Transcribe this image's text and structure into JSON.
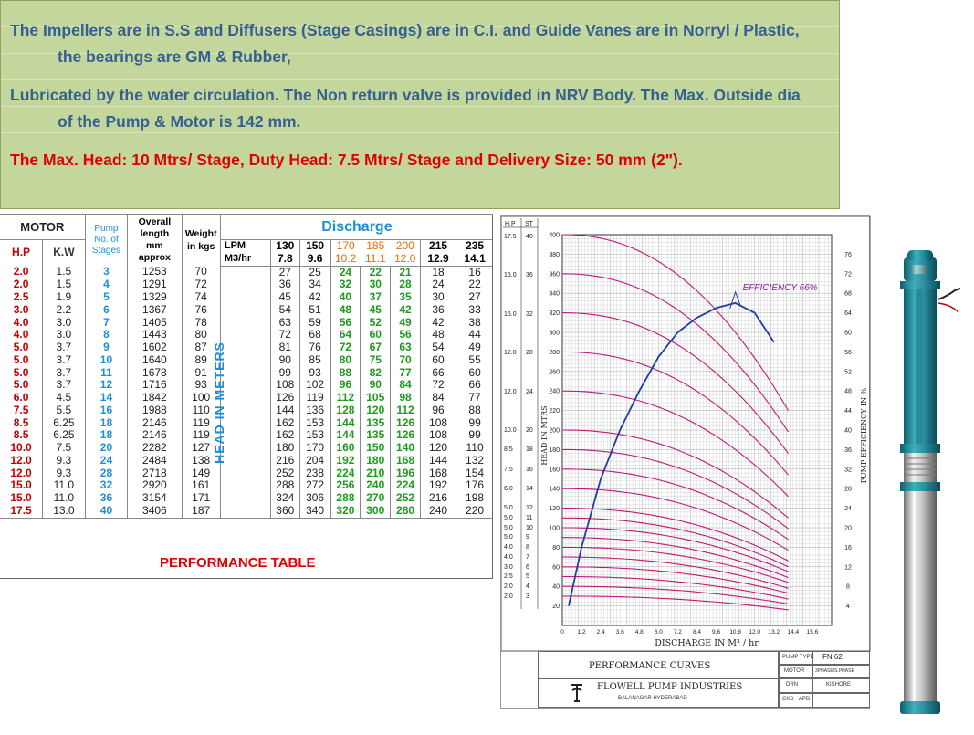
{
  "notes": {
    "line1": "The Impellers are in S.S and Diffusers (Stage Casings) are in C.I. and Guide Vanes are in Norryl / Plastic,",
    "line1b": "the bearings are GM & Rubber,",
    "line2": "Lubricated by the water circulation. The Non return valve is provided in NRV Body.  The Max.  Outside dia",
    "line2b": "of the Pump & Motor is 142 mm.",
    "line3": "The Max. Head: 10 Mtrs/ Stage, Duty Head: 7.5 Mtrs/ Stage and Delivery Size:  50 mm (2\")."
  },
  "table": {
    "motor": "MOTOR",
    "hp": "H.P",
    "kw": "K.W",
    "stages_1": "Pump",
    "stages_2": "No. of",
    "stages_3": "Stages",
    "length_1": "Overall",
    "length_2": "length",
    "length_3": "mm",
    "length_4": "approx",
    "weight_1": "Weight",
    "weight_2": "in kgs",
    "discharge": "Discharge",
    "lpm": "LPM",
    "m3hr": "M3/hr",
    "head_in_meters": "HEAD  IN  METERS",
    "lpm_values": [
      "130",
      "150",
      "170",
      "185",
      "200",
      "215",
      "235"
    ],
    "m3hr_values": [
      "7.8",
      "9.6",
      "10.2",
      "11.1",
      "12.0",
      "12.9",
      "14.1"
    ],
    "rows": [
      [
        "2.0",
        "1.5",
        "3",
        "1253",
        "70",
        "27",
        "25",
        "24",
        "22",
        "21",
        "18",
        "16"
      ],
      [
        "2.0",
        "1.5",
        "4",
        "1291",
        "72",
        "36",
        "34",
        "32",
        "30",
        "28",
        "24",
        "22"
      ],
      [
        "2.5",
        "1.9",
        "5",
        "1329",
        "74",
        "45",
        "42",
        "40",
        "37",
        "35",
        "30",
        "27"
      ],
      [
        "3.0",
        "2.2",
        "6",
        "1367",
        "76",
        "54",
        "51",
        "48",
        "45",
        "42",
        "36",
        "33"
      ],
      [
        "4.0",
        "3.0",
        "7",
        "1405",
        "78",
        "63",
        "59",
        "56",
        "52",
        "49",
        "42",
        "38"
      ],
      [
        "4.0",
        "3.0",
        "8",
        "1443",
        "80",
        "72",
        "68",
        "64",
        "60",
        "56",
        "48",
        "44"
      ],
      [
        "5.0",
        "3.7",
        "9",
        "1602",
        "87",
        "81",
        "76",
        "72",
        "67",
        "63",
        "54",
        "49"
      ],
      [
        "5.0",
        "3.7",
        "10",
        "1640",
        "89",
        "90",
        "85",
        "80",
        "75",
        "70",
        "60",
        "55"
      ],
      [
        "5.0",
        "3.7",
        "11",
        "1678",
        "91",
        "99",
        "93",
        "88",
        "82",
        "77",
        "66",
        "60"
      ],
      [
        "5.0",
        "3.7",
        "12",
        "1716",
        "93",
        "108",
        "102",
        "96",
        "90",
        "84",
        "72",
        "66"
      ],
      [
        "6.0",
        "4.5",
        "14",
        "1842",
        "100",
        "126",
        "119",
        "112",
        "105",
        "98",
        "84",
        "77"
      ],
      [
        "7.5",
        "5.5",
        "16",
        "1988",
        "110",
        "144",
        "136",
        "128",
        "120",
        "112",
        "96",
        "88"
      ],
      [
        "8.5",
        "6.25",
        "18",
        "2146",
        "119",
        "162",
        "153",
        "144",
        "135",
        "126",
        "108",
        "99"
      ],
      [
        "8.5",
        "6.25",
        "18",
        "2146",
        "119",
        "162",
        "153",
        "144",
        "135",
        "126",
        "108",
        "99"
      ],
      [
        "10.0",
        "7.5",
        "20",
        "2282",
        "127",
        "180",
        "170",
        "160",
        "150",
        "140",
        "120",
        "110"
      ],
      [
        "12.0",
        "9.3",
        "24",
        "2484",
        "138",
        "216",
        "204",
        "192",
        "180",
        "168",
        "144",
        "132"
      ],
      [
        "12.0",
        "9.3",
        "28",
        "2718",
        "149",
        "252",
        "238",
        "224",
        "210",
        "196",
        "168",
        "154"
      ],
      [
        "15.0",
        "11.0",
        "32",
        "2920",
        "161",
        "288",
        "272",
        "256",
        "240",
        "224",
        "192",
        "176"
      ],
      [
        "15.0",
        "11.0",
        "36",
        "3154",
        "171",
        "324",
        "306",
        "288",
        "270",
        "252",
        "216",
        "198"
      ],
      [
        "17.5",
        "13.0",
        "40",
        "3406",
        "187",
        "360",
        "340",
        "320",
        "300",
        "280",
        "240",
        "220"
      ]
    ],
    "title": "PERFORMANCE TABLE"
  },
  "curves": {
    "col_hp": "H.P",
    "col_st": "ST",
    "hp_st_labels": [
      [
        "17.5",
        "40"
      ],
      [
        "15.0",
        "36"
      ],
      [
        "15.0",
        "32"
      ],
      [
        "12.0",
        "28"
      ],
      [
        "12.0",
        "24"
      ],
      [
        "10.0",
        "20"
      ],
      [
        "8.5",
        "18"
      ],
      [
        "7.5",
        "16"
      ],
      [
        "6.0",
        "14"
      ],
      [
        "5.0",
        "12"
      ],
      [
        "5.0",
        "11"
      ],
      [
        "5.0",
        "10"
      ],
      [
        "5.0",
        "9"
      ],
      [
        "4.0",
        "8"
      ],
      [
        "4.0",
        "7"
      ],
      [
        "3.0",
        "6"
      ],
      [
        "2.5",
        "5"
      ],
      [
        "2.0",
        "4"
      ],
      [
        "2.0",
        "3"
      ]
    ],
    "head_ticks": [
      "400",
      "380",
      "360",
      "340",
      "320",
      "300",
      "280",
      "260",
      "240",
      "220",
      "200",
      "180",
      "160",
      "140",
      "120",
      "100",
      "80",
      "60",
      "40",
      "20"
    ],
    "x_ticks": [
      "0",
      "1.2",
      "2.4",
      "3.6",
      "4.8",
      "6.0",
      "7.2",
      "8.4",
      "9.6",
      "10.8",
      "12.0",
      "13.2",
      "14.4",
      "15.6"
    ],
    "eff_ticks": [
      "76",
      "72",
      "68",
      "64",
      "60",
      "56",
      "52",
      "48",
      "44",
      "40",
      "36",
      "32",
      "28",
      "24",
      "20",
      "16",
      "12",
      "8",
      "4"
    ],
    "head_axis_label": "HEAD   IN   MTRS",
    "eff_axis_label": "PUMP  EFFICIENCY   IN   %",
    "x_axis_label": "DISCHARGE IN M³ / hr",
    "efficiency_label": "EFFICIENCY 66%",
    "title": "PERFORMANCE  CURVES",
    "company": "FLOWELL  PUMP  INDUSTRIES",
    "address": "BALANAGAR HYDERABAD",
    "pump_type_label": "PUMP TYPE",
    "pump_type": "FN 62",
    "motor_label": "MOTOR",
    "motor": "3PHASE/S.PHASE",
    "drn_label": "DRN",
    "drn": "KISHORE",
    "ckd_label": "CKD",
    "apd_label": "APD"
  },
  "chart_data": {
    "type": "line",
    "xlabel": "DISCHARGE IN M³ / hr",
    "ylabel": "HEAD   IN   MTRS",
    "xlim": [
      0,
      16.8
    ],
    "ylim": [
      0,
      400
    ],
    "y2label": "PUMP  EFFICIENCY   IN   %",
    "y2lim": [
      0,
      80
    ],
    "series_head_by_stages": {
      "stages": [
        40,
        36,
        32,
        28,
        24,
        20,
        18,
        16,
        14,
        12,
        11,
        10,
        9,
        8,
        7,
        6,
        5,
        4,
        3
      ],
      "shutoff_head": [
        400,
        360,
        320,
        280,
        240,
        200,
        180,
        160,
        140,
        120,
        110,
        100,
        90,
        80,
        70,
        60,
        50,
        40,
        30
      ],
      "head_at_14_1": [
        220,
        198,
        176,
        154,
        132,
        110,
        99,
        88,
        77,
        66,
        60,
        55,
        49,
        44,
        38,
        33,
        27,
        22,
        16
      ]
    },
    "efficiency_curve": {
      "x": [
        0.4,
        1.2,
        2.4,
        3.6,
        4.8,
        6.0,
        7.2,
        8.4,
        9.6,
        10.8,
        12.0,
        13.2
      ],
      "y": [
        4,
        16,
        30,
        40,
        48,
        55,
        60,
        63,
        65,
        66,
        64,
        58
      ]
    },
    "annotations": [
      "EFFICIENCY 66%"
    ]
  }
}
